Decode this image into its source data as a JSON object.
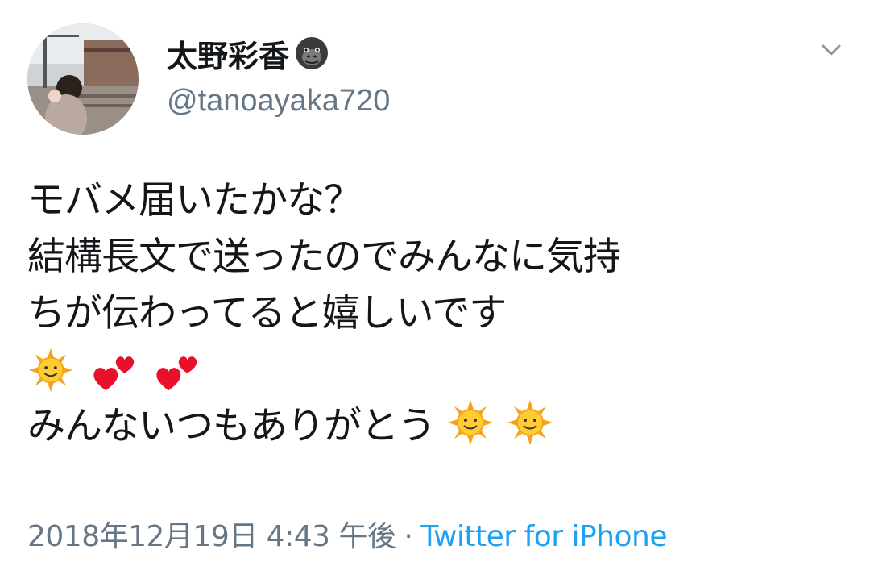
{
  "user": {
    "display_name": "太野彩香",
    "name_emoji": "gorilla-icon",
    "handle": "@tanoayaka720"
  },
  "tweet": {
    "lines": [
      "モバメ届いたかな？",
      "結構長文で送ったのでみんなに気持",
      "ちが伝わってると嬉しいです",
      "みんないつもありがとう"
    ],
    "emoji_line": [
      "sun-with-face-icon",
      "two-hearts-icon",
      "two-hearts-icon"
    ],
    "trailing_emojis": [
      "sun-with-face-icon",
      "sun-with-face-icon"
    ]
  },
  "meta": {
    "timestamp": "2018年12月19日 4:43 午後",
    "separator": "·",
    "source": "Twitter for iPhone"
  },
  "colors": {
    "text": "#14171a",
    "secondary": "#657786",
    "link": "#1da1f2",
    "background": "#ffffff"
  }
}
